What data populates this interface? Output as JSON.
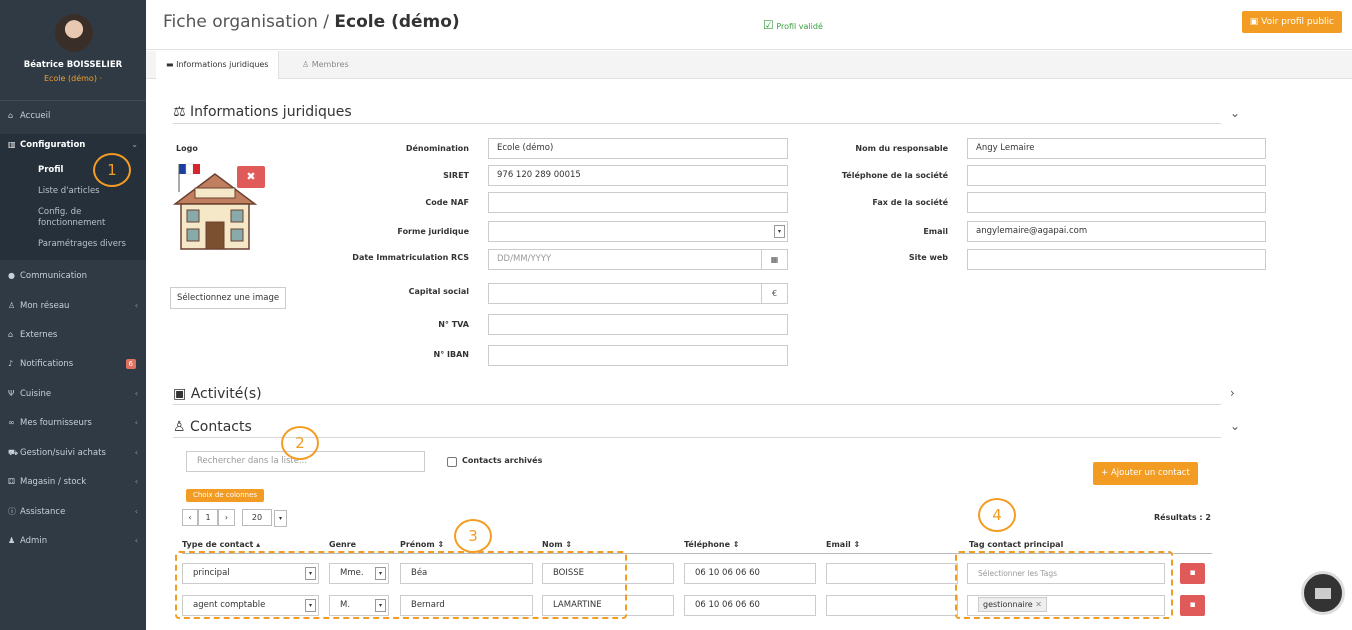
{
  "user": {
    "name": "Béatrice BOISSELIER",
    "org": "Ecole (démo) ·"
  },
  "nav": {
    "accueil": "Accueil",
    "configuration": "Configuration",
    "sub": [
      "Profil",
      "Liste d'articles",
      "Config. de fonctionnement",
      "Paramétrages divers"
    ],
    "communication": "Communication",
    "reseau": "Mon réseau",
    "externes": "Externes",
    "notifications": "Notifications",
    "notif_badge": "6",
    "cuisine": "Cuisine",
    "fournisseurs": "Mes fournisseurs",
    "gestion": "Gestion/suivi achats",
    "magasin": "Magasin / stock",
    "assistance": "Assistance",
    "admin": "Admin"
  },
  "header": {
    "title_prefix": "Fiche organisation / ",
    "title_org": "Ecole (démo)",
    "verified": "Profil validé",
    "public_btn": "Voir profil public"
  },
  "tabs": [
    "Informations juridiques",
    "Membres"
  ],
  "legal": {
    "heading": "Informations juridiques",
    "logo_label": "Logo",
    "select_image": "Sélectionnez une image",
    "labels": {
      "denomination": "Dénomination",
      "siret": "SIRET",
      "naf": "Code NAF",
      "forme": "Forme juridique",
      "date": "Date Immatriculation RCS",
      "capital": "Capital social",
      "tva": "N° TVA",
      "iban": "N° IBAN",
      "responsable": "Nom du responsable",
      "tel": "Téléphone de la société",
      "fax": "Fax de la société",
      "email": "Email",
      "web": "Site web"
    },
    "values": {
      "denomination": "Ecole (démo)",
      "siret": "976 120 289 00015",
      "date_placeholder": "DD/MM/YYYY",
      "currency": "€",
      "responsable": "Angy Lemaire",
      "email": "angylemaire@agapai.com"
    }
  },
  "activite": {
    "heading": "Activité(s)"
  },
  "contacts": {
    "heading": "Contacts",
    "search_placeholder": "Rechercher dans la liste...",
    "archived": "Contacts archivés",
    "add_btn": "+ Ajouter un contact",
    "columns_btn": "Choix de colonnes",
    "pager": {
      "page": "1",
      "per_page": "20"
    },
    "results": "Résultats : 2",
    "headers": [
      "Type de contact ▴",
      "Genre",
      "Prénom ⇕",
      "Nom ⇕",
      "Téléphone ⇕",
      "Email ⇕",
      "Tag contact principal"
    ],
    "rows": [
      {
        "type": "principal",
        "genre": "Mme.",
        "prenom": "Béa",
        "nom": "BOISSE",
        "tel": "06 10 06 06 60",
        "email": "",
        "tag_placeholder": "Sélectionner les Tags",
        "tag": ""
      },
      {
        "type": "agent comptable",
        "genre": "M.",
        "prenom": "Bernard",
        "nom": "LAMARTINE",
        "tel": "06 10 06 06 60",
        "email": "",
        "tag_placeholder": "",
        "tag": "gestionnaire"
      }
    ]
  },
  "callouts": [
    "1",
    "2",
    "3",
    "4"
  ],
  "colors": {
    "sidebar": "#2f3a44",
    "accent": "#f39c23",
    "danger": "#e05a5a",
    "success": "#3aa040"
  }
}
